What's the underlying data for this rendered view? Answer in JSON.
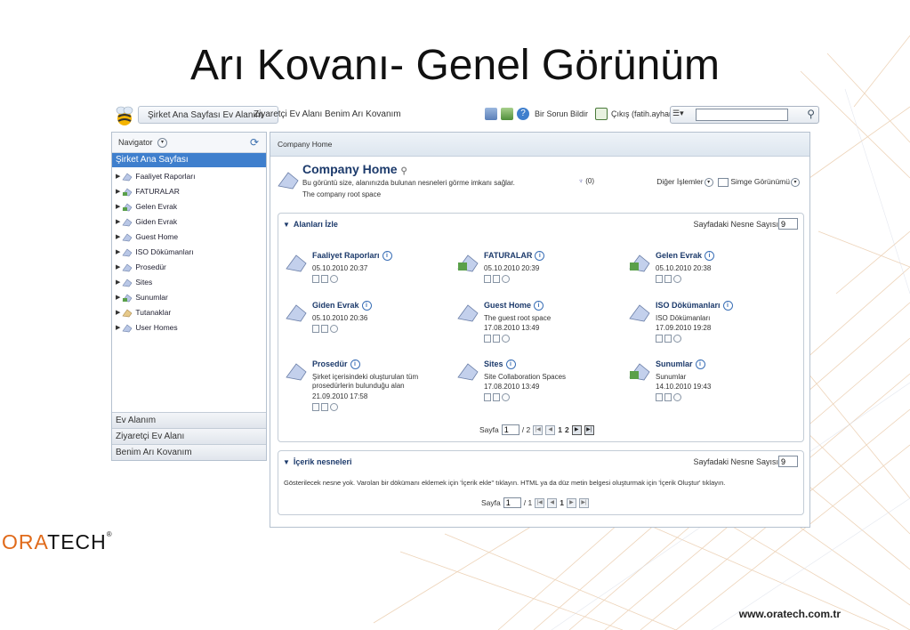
{
  "slide": {
    "title": "Arı Kovanı- Genel Görünüm",
    "logo_prefix": "ORA",
    "logo_suffix": "TECH",
    "logo_reg": "®",
    "url": "www.oratech.com.tr"
  },
  "toolbar": {
    "nav_links": "Şirket Ana Sayfası  Ev Alanım  Ziyaretçi Ev Alanı  Benim Arı Kovanım",
    "nav_first": "Şirket Ana Sayfası Ev Alanım",
    "nav_rest": "Ziyaretçi Ev Alanı  Benim Arı Kovanım",
    "report_issue": "Bir Sorun Bildir",
    "logout": "Çıkış (fatih.ayhan)",
    "search_value": ""
  },
  "navigator": {
    "title": "Navigator",
    "active": "Şirket Ana Sayfası",
    "items": [
      {
        "label": "Faaliyet Raporları"
      },
      {
        "label": "FATURALAR"
      },
      {
        "label": "Gelen Evrak"
      },
      {
        "label": "Giden Evrak"
      },
      {
        "label": "Guest Home"
      },
      {
        "label": "ISO Dökümanları"
      },
      {
        "label": "Prosedür"
      },
      {
        "label": "Sites"
      },
      {
        "label": "Sunumlar"
      },
      {
        "label": "Tutanaklar"
      },
      {
        "label": "User Homes"
      }
    ],
    "sections": [
      "Ev Alanım",
      "Ziyaretçi Ev Alanı",
      "Benim Arı Kovanım"
    ]
  },
  "main": {
    "breadcrumb": "Company Home",
    "title": "Company Home",
    "description": "Bu görüntü size, alanınızda bulunan nesneleri görme imkanı sağlar.",
    "subtitle": "The company root space",
    "count": "(0)",
    "other_actions": "Diğer İşlemler",
    "icon_view": "Simge Görünümü"
  },
  "spaces_panel": {
    "title": "Alanları İzle",
    "page_count_label": "Sayfadaki Nesne Sayısı",
    "page_count_value": "9",
    "items": [
      {
        "title": "Faaliyet Raporları",
        "line1": "05.10.2010 20:37",
        "line2": "",
        "line3": ""
      },
      {
        "title": "FATURALAR",
        "line1": "05.10.2010 20:39",
        "line2": "",
        "line3": ""
      },
      {
        "title": "Gelen Evrak",
        "line1": "05.10.2010 20:38",
        "line2": "",
        "line3": ""
      },
      {
        "title": "Giden Evrak",
        "line1": "05.10.2010 20:36",
        "line2": "",
        "line3": ""
      },
      {
        "title": "Guest Home",
        "line1": "The guest root space",
        "line2": "17.08.2010 13:49",
        "line3": ""
      },
      {
        "title": "ISO Dökümanları",
        "line1": "ISO Dökümanları",
        "line2": "17.09.2010 19:28",
        "line3": ""
      },
      {
        "title": "Prosedür",
        "line1": "Şirket içerisindeki oluşturulan tüm",
        "line2": "prosedürlerin bulunduğu alan",
        "line3": "21.09.2010 17:58"
      },
      {
        "title": "Sites",
        "line1": "Site Collaboration Spaces",
        "line2": "17.08.2010 13:49",
        "line3": ""
      },
      {
        "title": "Sunumlar",
        "line1": "Sunumlar",
        "line2": "14.10.2010 19:43",
        "line3": ""
      }
    ],
    "pager": {
      "label": "Sayfa",
      "value": "1",
      "total": "/ 2",
      "p1": "1",
      "p2": "2"
    }
  },
  "content_panel": {
    "title": "İçerik nesneleri",
    "page_count_label": "Sayfadaki Nesne Sayısı",
    "page_count_value": "9",
    "empty_message": "Gösterilecek nesne yok. Varolan bir dökümanı eklemek için 'İçerik ekle\" tıklayın. HTML ya da düz metin belgesi oluşturmak için 'İçerik Oluştur' tıklayın.",
    "pager": {
      "label": "Sayfa",
      "value": "1",
      "total": "/ 1",
      "p1": "1"
    }
  },
  "colors": {
    "accent": "#3f7fcd",
    "title_blue": "#1c3a6b"
  }
}
